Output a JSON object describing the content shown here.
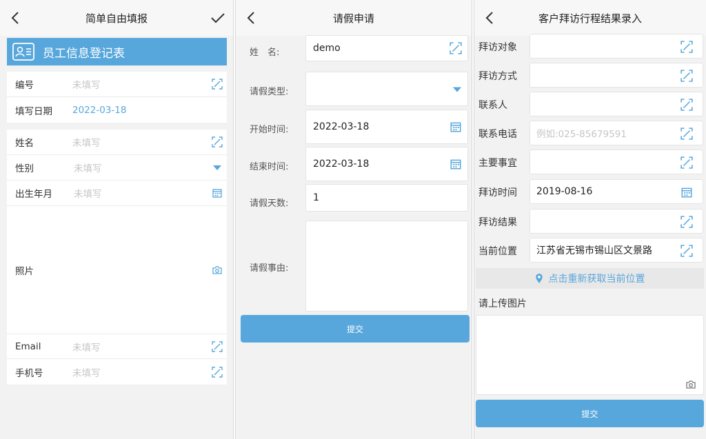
{
  "screen1": {
    "title": "简单自由填报",
    "banner": "员工信息登记表",
    "rows": [
      {
        "label": "编号",
        "value": "未填写"
      },
      {
        "label": "填写日期",
        "value": "2022-03-18"
      },
      {
        "label": "姓名",
        "value": "未填写"
      },
      {
        "label": "性别",
        "value": "未填写"
      },
      {
        "label": "出生年月",
        "value": "未填写"
      },
      {
        "label": "照片",
        "value": ""
      },
      {
        "label": "Email",
        "value": "未填写"
      },
      {
        "label": "手机号",
        "value": "未填写"
      }
    ]
  },
  "screen2": {
    "title": "请假申请",
    "fields": [
      {
        "label": "姓　名:",
        "value": "demo"
      },
      {
        "label": "请假类型:",
        "value": ""
      },
      {
        "label": "开始时间:",
        "value": "2022-03-18"
      },
      {
        "label": "结束时间:",
        "value": "2022-03-18"
      },
      {
        "label": "请假天数:",
        "value": "1"
      },
      {
        "label": "请假事由:",
        "value": ""
      }
    ],
    "submit": "提交"
  },
  "screen3": {
    "title": "客户拜访行程结果录入",
    "fields": [
      {
        "label": "拜访对象",
        "value": ""
      },
      {
        "label": "拜访方式",
        "value": ""
      },
      {
        "label": "联系人",
        "value": ""
      },
      {
        "label": "联系电话",
        "value": "",
        "placeholder": "例如:025-85679591"
      },
      {
        "label": "主要事宜",
        "value": ""
      },
      {
        "label": "拜访时间",
        "value": "2019-08-16"
      },
      {
        "label": "拜访结果",
        "value": ""
      },
      {
        "label": "当前位置",
        "value": "江苏省无锡市锡山区文景路"
      }
    ],
    "relocate": "点击重新获取当前位置",
    "upload_label": "请上传图片",
    "submit": "提交"
  },
  "colors": {
    "accent": "#58a7dc",
    "placeholder": "#c6c6c6",
    "background": "#f2f2f2"
  }
}
